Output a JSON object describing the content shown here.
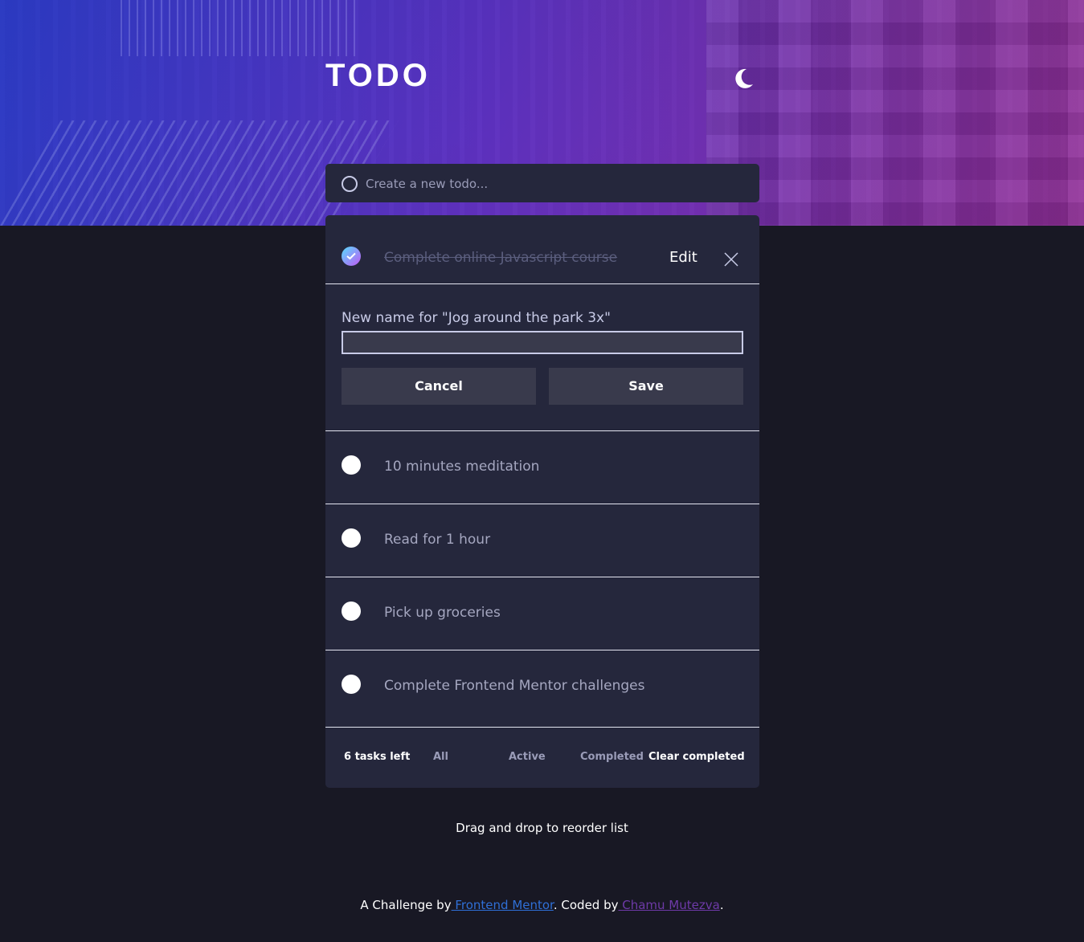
{
  "header": {
    "title": "TODO",
    "theme_icon": "moon-icon"
  },
  "new_todo": {
    "placeholder": "Create a new todo...",
    "value": ""
  },
  "todos": [
    {
      "text": "Complete online Javascript course",
      "completed": true
    },
    {
      "text": "10 minutes meditation",
      "completed": false
    },
    {
      "text": "Read for 1 hour",
      "completed": false
    },
    {
      "text": "Pick up groceries",
      "completed": false
    },
    {
      "text": "Complete Frontend Mentor challenges",
      "completed": false
    }
  ],
  "item_actions": {
    "edit_label": "Edit",
    "delete_icon": "close-icon"
  },
  "edit_form": {
    "label": "New name for \"Jog around the park 3x\"",
    "value": "",
    "cancel_label": "Cancel",
    "save_label": "Save"
  },
  "footer": {
    "count": "6 tasks left",
    "filters": [
      "All",
      "Active",
      "Completed"
    ],
    "clear_label": "Clear completed"
  },
  "hint": "Drag and drop to reorder list",
  "attribution": {
    "prefix": "A Challenge by",
    "fm_link": " Frontend Mentor",
    "sep": ".   Coded by",
    "author_link": " Chamu Mutezva",
    "suffix": "."
  },
  "colors": {
    "accent_gradient_start": "#57ddff",
    "accent_gradient_end": "#c058f3",
    "card_bg": "#25273c",
    "page_bg": "#181824"
  }
}
